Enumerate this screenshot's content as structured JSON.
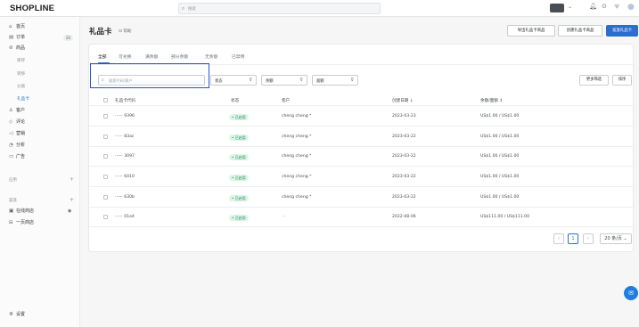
{
  "app": {
    "logo": "SHOPLINE"
  },
  "topbar": {
    "search_icon": "search-icon",
    "search_placeholder": "搜索",
    "icons": [
      "bell-icon",
      "help-icon",
      "wifi-icon",
      "avatar-icon"
    ]
  },
  "sidebar": {
    "items": [
      {
        "icon": "home-icon",
        "label": "首页"
      },
      {
        "icon": "orders-icon",
        "label": "订单",
        "badge": "20"
      },
      {
        "icon": "products-icon",
        "label": "商品"
      }
    ],
    "sub_items": [
      "库存",
      "转移",
      "分类",
      "礼品卡"
    ],
    "items2": [
      {
        "icon": "customers-icon",
        "label": "客户"
      },
      {
        "icon": "reviews-icon",
        "label": "评论"
      },
      {
        "icon": "marketing-icon",
        "label": "营销"
      },
      {
        "icon": "analytics-icon",
        "label": "分析"
      },
      {
        "icon": "ads-icon",
        "label": "广告"
      }
    ],
    "group1": "应用",
    "group2": "渠道",
    "channels": [
      {
        "icon": "online-store-icon",
        "label": "在线商店"
      },
      {
        "icon": "pos-icon",
        "label": "一页商店"
      }
    ],
    "settings": {
      "icon": "settings-icon",
      "label": "设置"
    }
  },
  "page": {
    "title": "礼品卡",
    "help_label": "帮助",
    "buttons": [
      "导出礼品卡商品",
      "创建礼品卡商品",
      "发放礼品卡"
    ]
  },
  "tabs": [
    "全部",
    "可兑换",
    "满余额",
    "部分余额",
    "无余额",
    "已禁用"
  ],
  "filters": {
    "search_placeholder": "搜索代码/客户",
    "selects": [
      "状态",
      "余额",
      "面额"
    ],
    "more_label": "更多筛选",
    "sort_label": "排序"
  },
  "table": {
    "headers": [
      "礼品卡代码",
      "状态",
      "客户",
      "创建日期 ↓",
      "余额/面额 ↕"
    ],
    "rows": [
      {
        "code": "······ 9396",
        "status": "• 已启用",
        "customer": "cheng cheng *",
        "date": "2023-03-23",
        "balance": "US$1.00 / US$1.00"
      },
      {
        "code": "······ 83ac",
        "status": "• 已启用",
        "customer": "cheng cheng *",
        "date": "2023-03-22",
        "balance": "US$1.00 / US$1.00"
      },
      {
        "code": "······ 3097",
        "status": "• 已启用",
        "customer": "cheng cheng *",
        "date": "2023-03-22",
        "balance": "US$1.00 / US$1.00"
      },
      {
        "code": "······ 6410",
        "status": "• 已启用",
        "customer": "cheng cheng *",
        "date": "2023-03-22",
        "balance": "US$1.00 / US$1.00"
      },
      {
        "code": "······ 630b",
        "status": "• 已启用",
        "customer": "cheng cheng *",
        "date": "2023-03-22",
        "balance": "US$1.00 / US$1.00"
      },
      {
        "code": "······ 01e4",
        "status": "• 已启用",
        "customer": "—",
        "date": "2022-08-06",
        "balance": "US$111.00 / US$111.00"
      }
    ]
  },
  "pagination": {
    "prev": "‹",
    "current": "1",
    "next": "›",
    "per_page": "20 条/页 ⌄"
  },
  "chat_icon": "chat-icon"
}
